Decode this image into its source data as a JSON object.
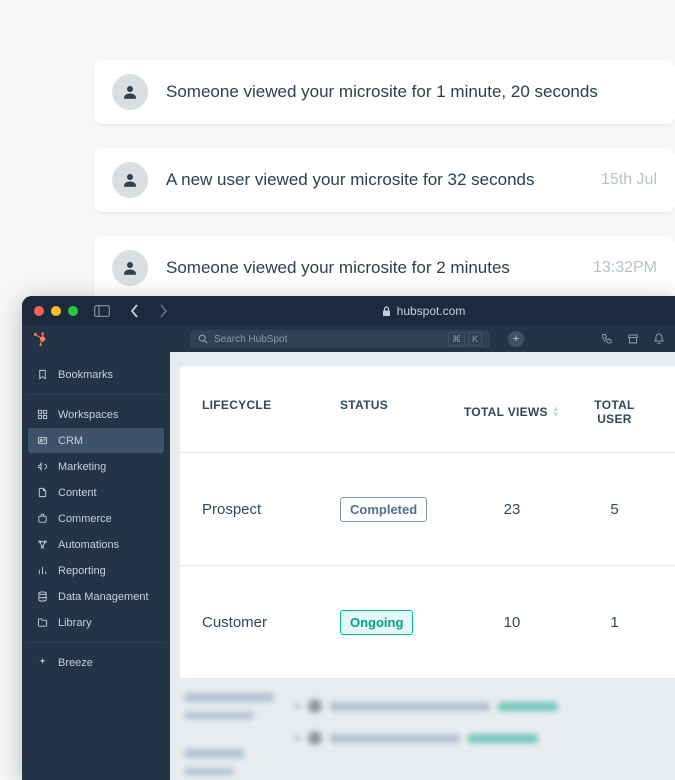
{
  "notifications": [
    {
      "text": "Someone viewed your microsite for 1 minute, 20 seconds",
      "time": ""
    },
    {
      "text": "A new user viewed your microsite for 32 seconds",
      "time": "15th Jul"
    },
    {
      "text": "Someone viewed your microsite for 2 minutes",
      "time": "13:32PM"
    }
  ],
  "browser": {
    "address": "hubspot.com"
  },
  "search": {
    "placeholder": "Search HubSpot",
    "kbd1": "⌘",
    "kbd2": "K"
  },
  "sidebar": {
    "items": [
      {
        "label": "Bookmarks",
        "icon": "bookmark"
      },
      {
        "label": "Workspaces",
        "icon": "grid"
      },
      {
        "label": "CRM",
        "icon": "id",
        "active": true
      },
      {
        "label": "Marketing",
        "icon": "megaphone"
      },
      {
        "label": "Content",
        "icon": "page"
      },
      {
        "label": "Commerce",
        "icon": "cart"
      },
      {
        "label": "Automations",
        "icon": "automation"
      },
      {
        "label": "Reporting",
        "icon": "bars"
      },
      {
        "label": "Data Management",
        "icon": "database"
      },
      {
        "label": "Library",
        "icon": "folder"
      }
    ],
    "breeze": "Breeze"
  },
  "table": {
    "headers": {
      "lifecycle": "LIFECYCLE",
      "status": "STATUS",
      "views": "TOTAL VIEWS",
      "users": "TOTAL USER"
    },
    "rows": [
      {
        "lifecycle": "Prospect",
        "status": "Completed",
        "status_kind": "completed",
        "views": "23",
        "users": "5"
      },
      {
        "lifecycle": "Customer",
        "status": "Ongoing",
        "status_kind": "ongoing",
        "views": "10",
        "users": "1"
      }
    ]
  }
}
